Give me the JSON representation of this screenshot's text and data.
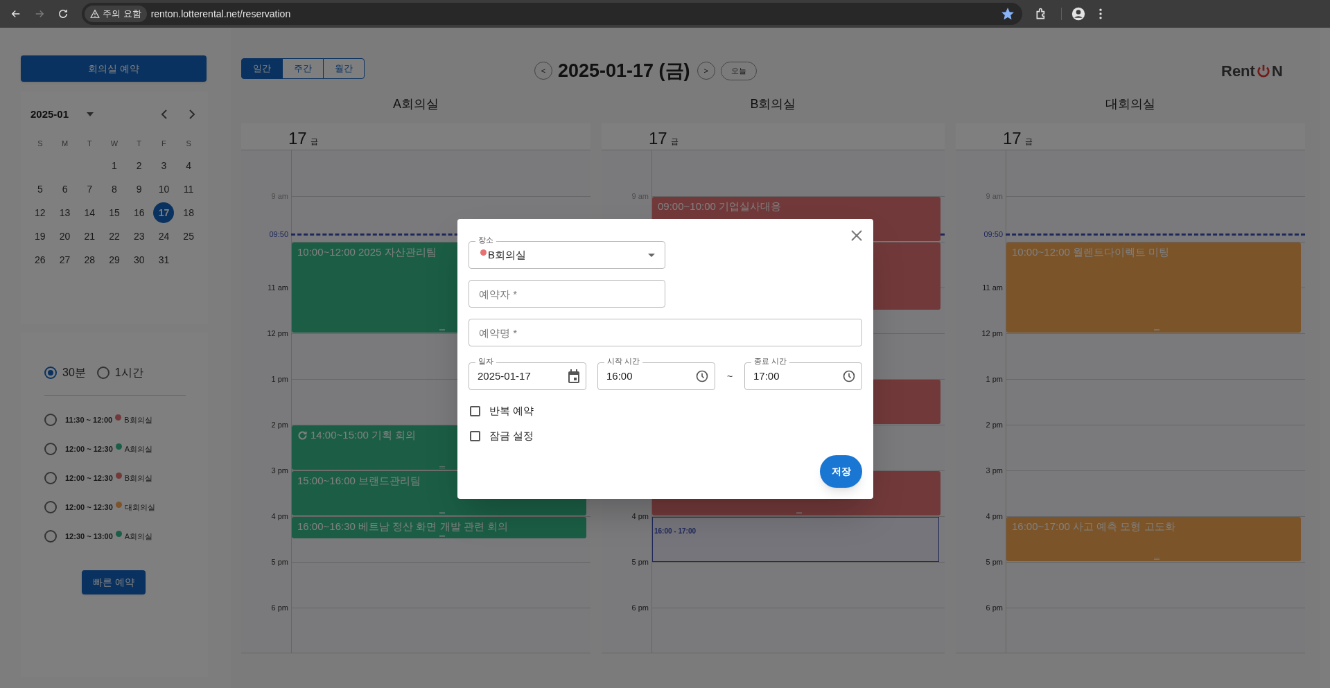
{
  "browser": {
    "nav": [
      {
        "kind": "back",
        "disabled": false
      },
      {
        "kind": "forward",
        "disabled": true
      },
      {
        "kind": "reload",
        "disabled": false
      }
    ],
    "warning": "주의 요함",
    "url": "renton.lotterental.net/reservation",
    "bookmarked": true
  },
  "sidebar": {
    "reserve_button": "회의실 예약",
    "mini_calendar": {
      "month": "2025-01",
      "weekdays": [
        "S",
        "M",
        "T",
        "W",
        "T",
        "F",
        "S"
      ],
      "weeks": [
        [
          {
            "day": "1",
            "selected": false
          },
          {
            "day": "2",
            "selected": false
          },
          {
            "day": "3",
            "selected": false
          },
          {
            "day": "4",
            "selected": false
          }
        ],
        [
          {
            "day": "5",
            "selected": false
          },
          {
            "day": "6",
            "selected": false
          },
          {
            "day": "7",
            "selected": false
          },
          {
            "day": "8",
            "selected": false
          },
          {
            "day": "9",
            "selected": false
          },
          {
            "day": "10",
            "selected": false
          },
          {
            "day": "11",
            "selected": false
          }
        ],
        [
          {
            "day": "12",
            "selected": false
          },
          {
            "day": "13",
            "selected": false
          },
          {
            "day": "14",
            "selected": false
          },
          {
            "day": "15",
            "selected": false
          },
          {
            "day": "16",
            "selected": false
          },
          {
            "day": "17",
            "selected": true
          },
          {
            "day": "18",
            "selected": false
          }
        ],
        [
          {
            "day": "19",
            "selected": false
          },
          {
            "day": "20",
            "selected": false
          },
          {
            "day": "21",
            "selected": false
          },
          {
            "day": "22",
            "selected": false
          },
          {
            "day": "23",
            "selected": false
          },
          {
            "day": "24",
            "selected": false
          },
          {
            "day": "25",
            "selected": false
          }
        ],
        [
          {
            "day": "26",
            "selected": false
          },
          {
            "day": "27",
            "selected": false
          },
          {
            "day": "28",
            "selected": false
          },
          {
            "day": "29",
            "selected": false
          },
          {
            "day": "30",
            "selected": false
          },
          {
            "day": "31",
            "selected": false
          }
        ]
      ]
    },
    "duration_options": [
      {
        "label": "30분",
        "selected": true
      },
      {
        "label": "1시간",
        "selected": false
      }
    ],
    "quick_slots": [
      {
        "time": "11:30 ~ 12:00",
        "room": "B회의실",
        "color": "#72393a",
        "selected": false
      },
      {
        "time": "12:00 ~ 12:30",
        "room": "A회의실",
        "color": "#1b5e45",
        "selected": false
      },
      {
        "time": "12:00 ~ 12:30",
        "room": "B회의실",
        "color": "#72393a",
        "selected": false
      },
      {
        "time": "12:00 ~ 12:30",
        "room": "대회의실",
        "color": "#7b5429",
        "selected": false
      },
      {
        "time": "12:30 ~ 13:00",
        "room": "A회의실",
        "color": "#1b5e45",
        "selected": false
      }
    ],
    "quick_button": "빠른 예약"
  },
  "toolbar": {
    "views": [
      {
        "label": "일간",
        "selected": true
      },
      {
        "label": "주간",
        "selected": false
      },
      {
        "label": "월간",
        "selected": false
      }
    ],
    "prev": "<",
    "date": "2025-01-17 (금)",
    "next": ">",
    "today": "오늘",
    "logo": {
      "before": "Rent",
      "after": "N"
    }
  },
  "rooms": [
    {
      "name": "A회의실",
      "day_number": "17",
      "day_name": "금",
      "color": "#1b5e45",
      "now_label": "09:50",
      "slots": [
        {
          "kind": "free"
        },
        {
          "kind": "free"
        },
        {
          "kind": "free",
          "hour_label": {
            "text": "9 am",
            "past": true
          }
        },
        {
          "kind": "free"
        },
        {
          "kind": "event",
          "title": "10:00~12:00 2025 자산관리팀",
          "recurring": false
        },
        {
          "kind": "more"
        },
        {
          "kind": "more",
          "hour_label": {
            "text": "11 am",
            "past": false
          }
        },
        {
          "kind": "more"
        },
        {
          "kind": "free",
          "hour_label": {
            "text": "12 pm",
            "past": false
          }
        },
        {
          "kind": "free"
        },
        {
          "kind": "free",
          "hour_label": {
            "text": "1 pm",
            "past": false
          }
        },
        {
          "kind": "free"
        },
        {
          "kind": "event",
          "title": "14:00~15:00 기획 회의",
          "recurring": true,
          "hour_label": {
            "text": "2 pm",
            "past": false
          }
        },
        {
          "kind": "more"
        },
        {
          "kind": "event",
          "title": "15:00~16:00 브랜드관리팀",
          "recurring": false,
          "hour_label": {
            "text": "3 pm",
            "past": false
          }
        },
        {
          "kind": "more"
        },
        {
          "kind": "event",
          "title": "16:00~16:30 베트남 정산 화면 개발 관련 회의",
          "recurring": false,
          "hour_label": {
            "text": "4 pm",
            "past": false
          }
        },
        {
          "kind": "free"
        },
        {
          "kind": "free",
          "hour_label": {
            "text": "5 pm",
            "past": false
          }
        },
        {
          "kind": "free"
        },
        {
          "kind": "free",
          "hour_label": {
            "text": "6 pm",
            "past": false
          }
        },
        {
          "kind": "free"
        }
      ]
    },
    {
      "name": "B회의실",
      "day_number": "17",
      "day_name": "금",
      "color": "#72393a",
      "slots": [
        {
          "kind": "free"
        },
        {
          "kind": "free"
        },
        {
          "kind": "event",
          "title": "09:00~10:00 기업실사대응",
          "recurring": false,
          "hour_label": {
            "text": "9 am",
            "past": true
          }
        },
        {
          "kind": "more"
        },
        {
          "kind": "event"
        },
        {
          "kind": "more"
        },
        {
          "kind": "more"
        },
        {
          "kind": "free"
        },
        {
          "kind": "free"
        },
        {
          "kind": "free"
        },
        {
          "kind": "event"
        },
        {
          "kind": "more"
        },
        {
          "kind": "free"
        },
        {
          "kind": "free"
        },
        {
          "kind": "event"
        },
        {
          "kind": "more"
        },
        {
          "kind": "selection",
          "label": "16:00 - 17:00",
          "hour_label": {
            "text": "4 pm",
            "past": false
          }
        },
        {
          "kind": "more"
        },
        {
          "kind": "free",
          "hour_label": {
            "text": "5 pm",
            "past": false
          }
        },
        {
          "kind": "free"
        },
        {
          "kind": "free",
          "hour_label": {
            "text": "6 pm",
            "past": false
          }
        },
        {
          "kind": "free"
        }
      ]
    },
    {
      "name": "대회의실",
      "day_number": "17",
      "day_name": "금",
      "color": "#7b5429",
      "now_label": "09:50",
      "slots": [
        {
          "kind": "free"
        },
        {
          "kind": "free"
        },
        {
          "kind": "free",
          "hour_label": {
            "text": "9 am",
            "past": true
          }
        },
        {
          "kind": "free"
        },
        {
          "kind": "event",
          "title": "10:00~12:00 월렌트다이렉트 미팅",
          "recurring": false
        },
        {
          "kind": "more"
        },
        {
          "kind": "more",
          "hour_label": {
            "text": "11 am",
            "past": false
          }
        },
        {
          "kind": "more"
        },
        {
          "kind": "free",
          "hour_label": {
            "text": "12 pm",
            "past": false
          }
        },
        {
          "kind": "free"
        },
        {
          "kind": "free",
          "hour_label": {
            "text": "1 pm",
            "past": false
          }
        },
        {
          "kind": "free"
        },
        {
          "kind": "free",
          "hour_label": {
            "text": "2 pm",
            "past": false
          }
        },
        {
          "kind": "free"
        },
        {
          "kind": "free",
          "hour_label": {
            "text": "3 pm",
            "past": false
          }
        },
        {
          "kind": "free"
        },
        {
          "kind": "event",
          "title": "16:00~17:00 사고 예측 모형 고도화",
          "recurring": false,
          "hour_label": {
            "text": "4 pm",
            "past": false
          }
        },
        {
          "kind": "more"
        },
        {
          "kind": "free",
          "hour_label": {
            "text": "5 pm",
            "past": false
          }
        },
        {
          "kind": "free"
        },
        {
          "kind": "free",
          "hour_label": {
            "text": "6 pm",
            "past": false
          }
        },
        {
          "kind": "free"
        }
      ]
    }
  ],
  "dialog": {
    "location": {
      "label": "장소",
      "value": "B회의실",
      "color": "#e57373"
    },
    "booker": {
      "placeholder": "예약자 *"
    },
    "title": {
      "placeholder": "예약명 *"
    },
    "date": {
      "label": "일자",
      "value": "2025-01-17"
    },
    "start": {
      "label": "시작 시간",
      "value": "16:00"
    },
    "separator": "~",
    "end": {
      "label": "종료 시간",
      "value": "17:00"
    },
    "checkboxes": [
      {
        "label": "반복 예약",
        "checked": false
      },
      {
        "label": "잠금 설정",
        "checked": false
      }
    ],
    "save": "저장"
  }
}
